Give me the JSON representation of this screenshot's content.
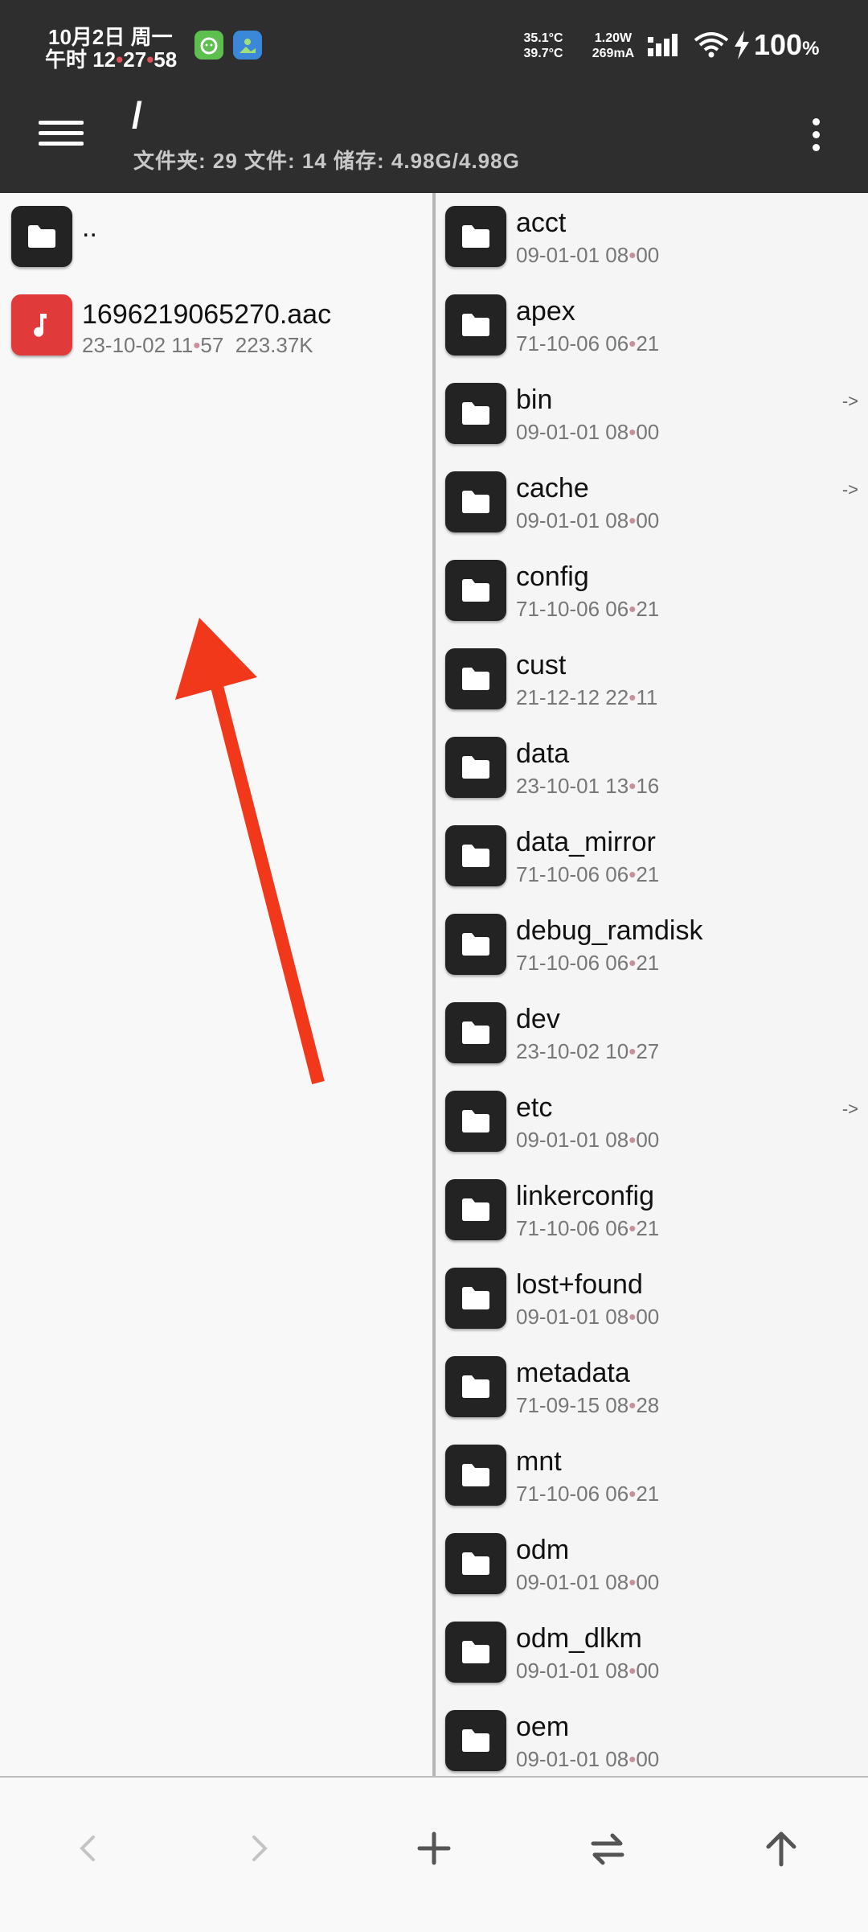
{
  "status_bar": {
    "date": "10月2日 周一",
    "time_prefix": "午时 12",
    "time_dot1": "•",
    "time_min": "27",
    "time_dot2": "•",
    "time_sec": "58",
    "temp_1": "35.1°C",
    "temp_2": "39.7°C",
    "power_w": "1.20W",
    "power_ma": "269mA",
    "battery": "100",
    "battery_unit": "%"
  },
  "toolbar": {
    "path": "/",
    "stats": "文件夹: 29  文件: 14  储存: 4.98G/4.98G"
  },
  "left_pane": {
    "items": [
      {
        "name": "..",
        "meta_date": "",
        "meta_time_h": "",
        "meta_time_m": "",
        "meta_size": "",
        "type": "folder"
      },
      {
        "name": "1696219065270.aac",
        "meta_date": "23-10-02 11",
        "meta_time_m": "57",
        "meta_size": "223.37K",
        "type": "audio"
      }
    ]
  },
  "right_pane": {
    "items": [
      {
        "name": "acct",
        "date": "09-01-01 08",
        "min": "00",
        "link": ""
      },
      {
        "name": "apex",
        "date": "71-10-06 06",
        "min": "21",
        "link": ""
      },
      {
        "name": "bin",
        "date": "09-01-01 08",
        "min": "00",
        "link": "->"
      },
      {
        "name": "cache",
        "date": "09-01-01 08",
        "min": "00",
        "link": "->"
      },
      {
        "name": "config",
        "date": "71-10-06 06",
        "min": "21",
        "link": ""
      },
      {
        "name": "cust",
        "date": "21-12-12 22",
        "min": "11",
        "link": ""
      },
      {
        "name": "data",
        "date": "23-10-01 13",
        "min": "16",
        "link": ""
      },
      {
        "name": "data_mirror",
        "date": "71-10-06 06",
        "min": "21",
        "link": ""
      },
      {
        "name": "debug_ramdisk",
        "date": "71-10-06 06",
        "min": "21",
        "link": ""
      },
      {
        "name": "dev",
        "date": "23-10-02 10",
        "min": "27",
        "link": ""
      },
      {
        "name": "etc",
        "date": "09-01-01 08",
        "min": "00",
        "link": "->"
      },
      {
        "name": "linkerconfig",
        "date": "71-10-06 06",
        "min": "21",
        "link": ""
      },
      {
        "name": "lost+found",
        "date": "09-01-01 08",
        "min": "00",
        "link": ""
      },
      {
        "name": "metadata",
        "date": "71-09-15 08",
        "min": "28",
        "link": ""
      },
      {
        "name": "mnt",
        "date": "71-10-06 06",
        "min": "21",
        "link": ""
      },
      {
        "name": "odm",
        "date": "09-01-01 08",
        "min": "00",
        "link": ""
      },
      {
        "name": "odm_dlkm",
        "date": "09-01-01 08",
        "min": "00",
        "link": ""
      },
      {
        "name": "oem",
        "date": "09-01-01 08",
        "min": "00",
        "link": ""
      }
    ]
  },
  "bottom_bar": {
    "buttons": [
      "back-icon",
      "forward-icon",
      "add-icon",
      "swap-icon",
      "up-icon"
    ]
  },
  "colors": {
    "header_bg": "#2e2e2e",
    "folder_icon_bg": "#232323",
    "audio_icon_bg": "#e03a3a",
    "annotation_arrow": "#f2381b"
  }
}
